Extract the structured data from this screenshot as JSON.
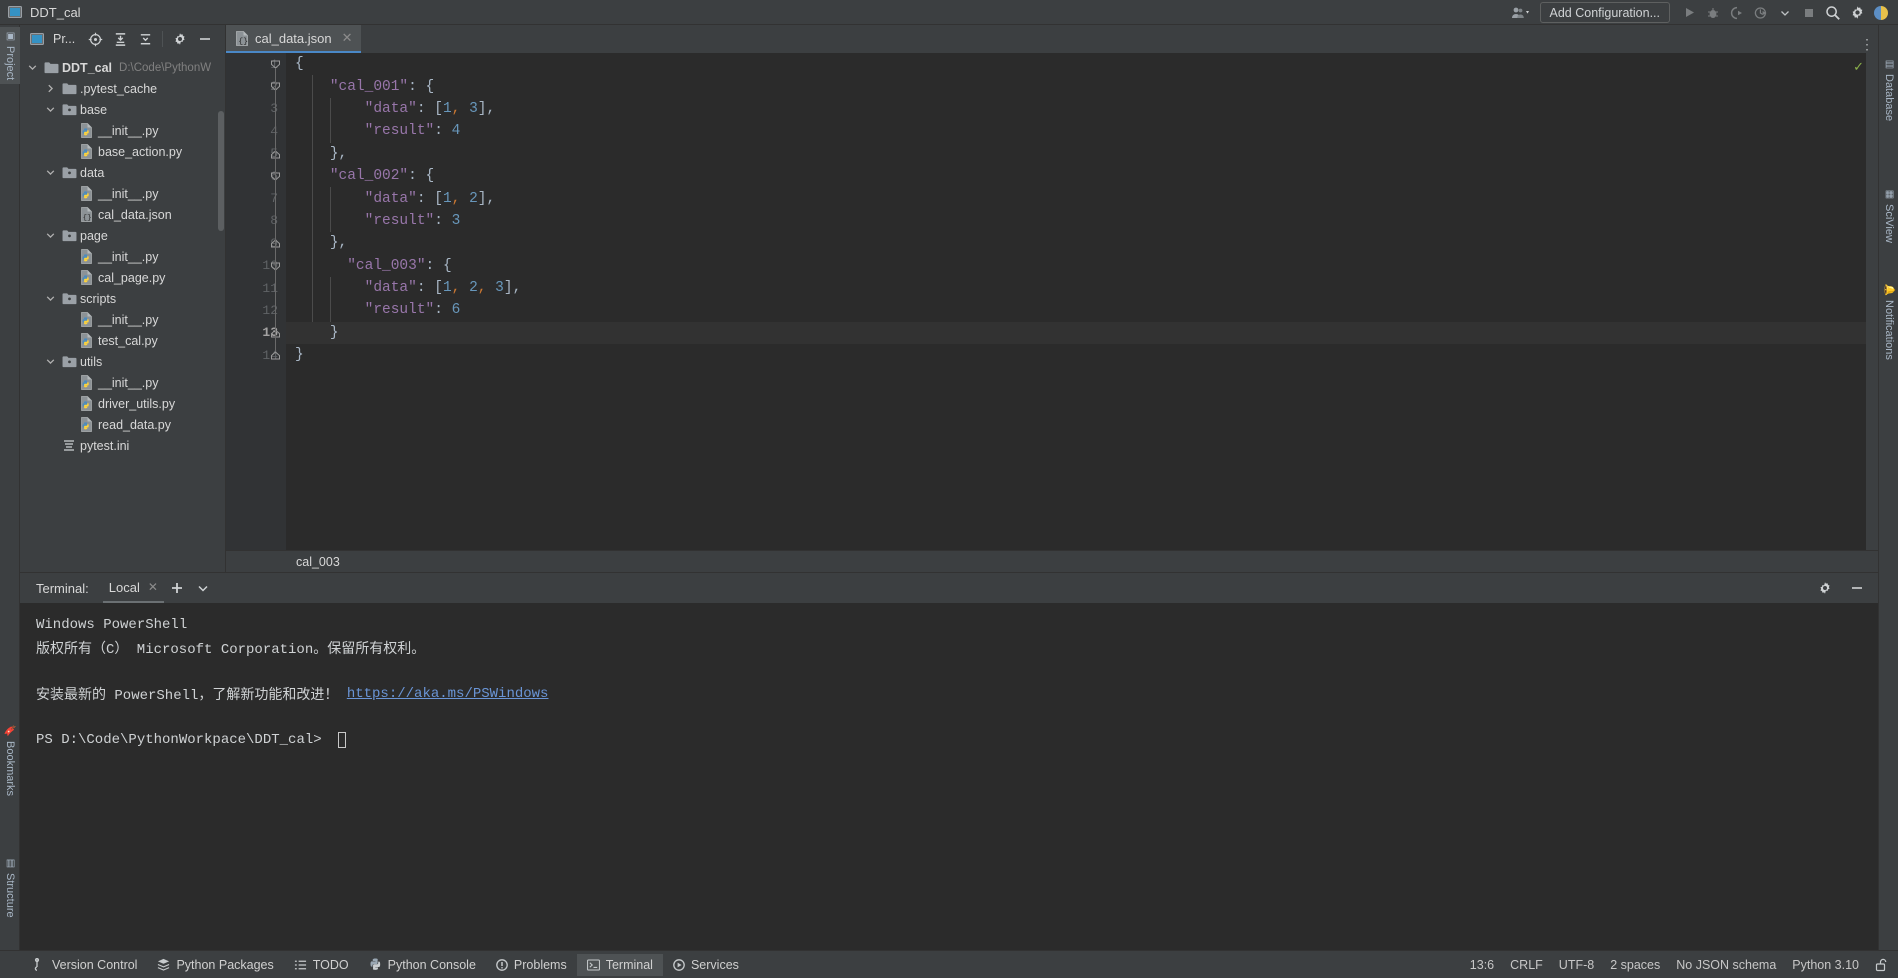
{
  "window": {
    "title": "DDT_cal",
    "project_icon": "project-window-icon"
  },
  "toolbar": {
    "user_icon": "user-dropdown-icon",
    "add_configuration": "Add Configuration...",
    "run_icon": "run-icon",
    "debug_icon": "debug-icon",
    "coverage_icon": "run-coverage-icon",
    "profile_icon": "run-profile-icon",
    "profile_dropdown_icon": "chevron-down-icon",
    "stop_icon": "stop-icon",
    "search_icon": "search-everywhere-icon",
    "settings_icon": "gear-icon",
    "avatar_icon": "account-avatar-icon"
  },
  "project_toolbar": {
    "label": "Pr...",
    "panel_icon": "project-panel-icon",
    "locate_icon": "select-opened-file-icon",
    "expand_icon": "expand-all-icon",
    "collapse_icon": "collapse-all-icon",
    "settings_icon": "gear-icon",
    "hide_icon": "hide-panel-icon"
  },
  "editor_tabs": [
    {
      "label": "cal_data.json",
      "icon": "json-file-icon",
      "active": true,
      "close_icon": "close-icon"
    }
  ],
  "tab_overflow_icon": "more-options-icon",
  "left_rail": [
    {
      "label": "Project",
      "icon": "project-icon",
      "active": true
    },
    {
      "label": "Bookmarks",
      "icon": "bookmarks-icon",
      "active": false
    },
    {
      "label": "Structure",
      "icon": "structure-icon",
      "active": false
    }
  ],
  "right_rail": [
    {
      "label": "Database",
      "icon": "database-icon"
    },
    {
      "label": "SciView",
      "icon": "sciview-icon"
    },
    {
      "label": "Notifications",
      "icon": "notifications-icon"
    }
  ],
  "project_tree": [
    {
      "label": "DDT_cal",
      "path": "D:\\Code\\PythonW",
      "indent": 0,
      "arrow": "down",
      "icon": "folder-icon",
      "bold": true
    },
    {
      "label": ".pytest_cache",
      "indent": 1,
      "arrow": "right",
      "icon": "folder-icon"
    },
    {
      "label": "base",
      "indent": 1,
      "arrow": "down",
      "icon": "package-folder-icon"
    },
    {
      "label": "__init__.py",
      "indent": 2,
      "arrow": "none",
      "icon": "python-file-icon"
    },
    {
      "label": "base_action.py",
      "indent": 2,
      "arrow": "none",
      "icon": "python-file-icon"
    },
    {
      "label": "data",
      "indent": 1,
      "arrow": "down",
      "icon": "package-folder-icon"
    },
    {
      "label": "__init__.py",
      "indent": 2,
      "arrow": "none",
      "icon": "python-file-icon"
    },
    {
      "label": "cal_data.json",
      "indent": 2,
      "arrow": "none",
      "icon": "json-file-icon"
    },
    {
      "label": "page",
      "indent": 1,
      "arrow": "down",
      "icon": "package-folder-icon"
    },
    {
      "label": "__init__.py",
      "indent": 2,
      "arrow": "none",
      "icon": "python-file-icon"
    },
    {
      "label": "cal_page.py",
      "indent": 2,
      "arrow": "none",
      "icon": "python-file-icon"
    },
    {
      "label": "scripts",
      "indent": 1,
      "arrow": "down",
      "icon": "package-folder-icon"
    },
    {
      "label": "__init__.py",
      "indent": 2,
      "arrow": "none",
      "icon": "python-file-icon"
    },
    {
      "label": "test_cal.py",
      "indent": 2,
      "arrow": "none",
      "icon": "python-file-icon"
    },
    {
      "label": "utils",
      "indent": 1,
      "arrow": "down",
      "icon": "package-folder-icon"
    },
    {
      "label": "__init__.py",
      "indent": 2,
      "arrow": "none",
      "icon": "python-file-icon"
    },
    {
      "label": "driver_utils.py",
      "indent": 2,
      "arrow": "none",
      "icon": "python-file-icon"
    },
    {
      "label": "read_data.py",
      "indent": 2,
      "arrow": "none",
      "icon": "python-file-icon"
    },
    {
      "label": "pytest.ini",
      "indent": 1,
      "arrow": "none",
      "icon": "ini-file-icon"
    }
  ],
  "editor": {
    "current_line": 13,
    "inspection_icon": "inspections-ok-icon",
    "lines": [
      {
        "n": 1,
        "indent": 0,
        "tokens": [
          {
            "t": "{",
            "c": "punct"
          }
        ]
      },
      {
        "n": 2,
        "indent": 2,
        "tokens": [
          {
            "t": "\"cal_001\"",
            "c": "key"
          },
          {
            "t": ": ",
            "c": "punct"
          },
          {
            "t": "{",
            "c": "punct"
          }
        ]
      },
      {
        "n": 3,
        "indent": 4,
        "tokens": [
          {
            "t": "\"data\"",
            "c": "key"
          },
          {
            "t": ": [",
            "c": "punct"
          },
          {
            "t": "1",
            "c": "num"
          },
          {
            "t": ", ",
            "c": "col"
          },
          {
            "t": "3",
            "c": "num"
          },
          {
            "t": "],",
            "c": "punct"
          }
        ]
      },
      {
        "n": 4,
        "indent": 4,
        "tokens": [
          {
            "t": "\"result\"",
            "c": "key"
          },
          {
            "t": ": ",
            "c": "punct"
          },
          {
            "t": "4",
            "c": "num"
          }
        ]
      },
      {
        "n": 5,
        "indent": 2,
        "tokens": [
          {
            "t": "},",
            "c": "punct"
          }
        ]
      },
      {
        "n": 6,
        "indent": 2,
        "tokens": [
          {
            "t": "\"cal_002\"",
            "c": "key"
          },
          {
            "t": ": ",
            "c": "punct"
          },
          {
            "t": "{",
            "c": "punct"
          }
        ]
      },
      {
        "n": 7,
        "indent": 4,
        "tokens": [
          {
            "t": "\"data\"",
            "c": "key"
          },
          {
            "t": ": [",
            "c": "punct"
          },
          {
            "t": "1",
            "c": "num"
          },
          {
            "t": ", ",
            "c": "col"
          },
          {
            "t": "2",
            "c": "num"
          },
          {
            "t": "],",
            "c": "punct"
          }
        ]
      },
      {
        "n": 8,
        "indent": 4,
        "tokens": [
          {
            "t": "\"result\"",
            "c": "key"
          },
          {
            "t": ": ",
            "c": "punct"
          },
          {
            "t": "3",
            "c": "num"
          }
        ]
      },
      {
        "n": 9,
        "indent": 2,
        "tokens": [
          {
            "t": "},",
            "c": "punct"
          }
        ]
      },
      {
        "n": 10,
        "indent": 3,
        "tokens": [
          {
            "t": "\"cal_003\"",
            "c": "key"
          },
          {
            "t": ": ",
            "c": "punct"
          },
          {
            "t": "{",
            "c": "punct"
          }
        ]
      },
      {
        "n": 11,
        "indent": 4,
        "tokens": [
          {
            "t": "\"data\"",
            "c": "key"
          },
          {
            "t": ": [",
            "c": "punct"
          },
          {
            "t": "1",
            "c": "num"
          },
          {
            "t": ", ",
            "c": "col"
          },
          {
            "t": "2",
            "c": "num"
          },
          {
            "t": ", ",
            "c": "col"
          },
          {
            "t": "3",
            "c": "num"
          },
          {
            "t": "],",
            "c": "punct"
          }
        ]
      },
      {
        "n": 12,
        "indent": 4,
        "tokens": [
          {
            "t": "\"result\"",
            "c": "key"
          },
          {
            "t": ": ",
            "c": "punct"
          },
          {
            "t": "6",
            "c": "num"
          }
        ]
      },
      {
        "n": 13,
        "indent": 2,
        "tokens": [
          {
            "t": "}",
            "c": "punct"
          }
        ],
        "current": true
      },
      {
        "n": 14,
        "indent": 0,
        "tokens": [
          {
            "t": "}",
            "c": "punct"
          }
        ]
      }
    ],
    "breadcrumb": "cal_003"
  },
  "terminal": {
    "label": "Terminal:",
    "tab": "Local",
    "tab_close_icon": "close-icon",
    "add_icon": "add-icon",
    "dropdown_icon": "chevron-down-icon",
    "settings_icon": "gear-icon",
    "minimize_icon": "minimize-icon",
    "lines": [
      {
        "text": "Windows PowerShell"
      },
      {
        "text": "版权所有（C） Microsoft Corporation。保留所有权利。"
      },
      {
        "text": ""
      },
      {
        "text": "安装最新的 PowerShell，了解新功能和改进！ ",
        "link": "https://aka.ms/PSWindows"
      },
      {
        "text": ""
      },
      {
        "text": "PS D:\\Code\\PythonWorkpace\\DDT_cal> ",
        "caret": true
      }
    ]
  },
  "status_bar": {
    "tools": [
      {
        "label": "Version Control",
        "icon": "version-control-icon",
        "active": false
      },
      {
        "label": "Python Packages",
        "icon": "python-packages-icon",
        "active": false
      },
      {
        "label": "TODO",
        "icon": "todo-icon",
        "active": false
      },
      {
        "label": "Python Console",
        "icon": "python-console-icon",
        "active": false
      },
      {
        "label": "Problems",
        "icon": "problems-icon",
        "active": false
      },
      {
        "label": "Terminal",
        "icon": "terminal-icon",
        "active": true
      },
      {
        "label": "Services",
        "icon": "services-icon",
        "active": false
      }
    ],
    "right": [
      {
        "label": "13:6",
        "name": "caret-position"
      },
      {
        "label": "CRLF",
        "name": "line-separator"
      },
      {
        "label": "UTF-8",
        "name": "file-encoding"
      },
      {
        "label": "2 spaces",
        "name": "indent-setting"
      },
      {
        "label": "No JSON schema",
        "name": "json-schema"
      },
      {
        "label": "Python 3.10",
        "name": "python-interpreter"
      }
    ],
    "lock_icon": "unlocked-icon"
  },
  "colors": {
    "accent": "#4a88c7",
    "bg_panel": "#3c3f41",
    "bg_editor": "#2b2b2b",
    "key": "#9876aa",
    "number": "#6897bb",
    "punct": "#a9b7c6",
    "link": "#6a95d6"
  }
}
